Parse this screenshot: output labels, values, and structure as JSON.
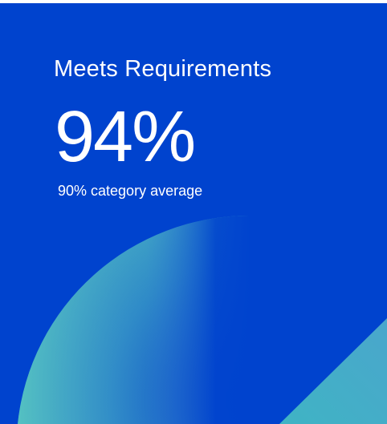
{
  "metric_card": {
    "title": "Meets Requirements",
    "value": "94%",
    "category_average": "90% category average"
  },
  "colors": {
    "background": "#0043ce",
    "accent_teal": "#4ec3c0",
    "text": "#ffffff"
  }
}
